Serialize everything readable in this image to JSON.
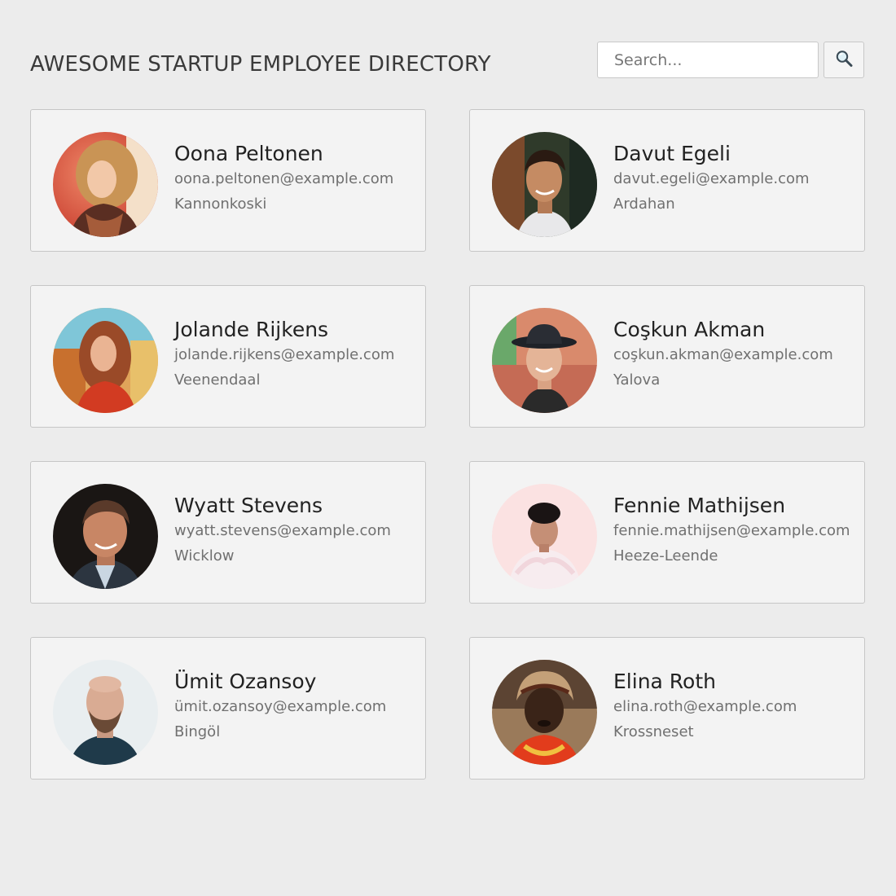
{
  "header": {
    "title": "AWESOME STARTUP EMPLOYEE DIRECTORY",
    "search": {
      "placeholder": "Search...",
      "value": "",
      "button_icon": "search-icon"
    }
  },
  "employees": [
    {
      "name": "Oona Peltonen",
      "email": "oona.peltonen@example.com",
      "city": "Kannonkoski"
    },
    {
      "name": "Davut Egeli",
      "email": "davut.egeli@example.com",
      "city": "Ardahan"
    },
    {
      "name": "Jolande Rijkens",
      "email": "jolande.rijkens@example.com",
      "city": "Veenendaal"
    },
    {
      "name": "Coşkun Akman",
      "email": "coşkun.akman@example.com",
      "city": "Yalova"
    },
    {
      "name": "Wyatt Stevens",
      "email": "wyatt.stevens@example.com",
      "city": "Wicklow"
    },
    {
      "name": "Fennie Mathijsen",
      "email": "fennie.mathijsen@example.com",
      "city": "Heeze-Leende"
    },
    {
      "name": "Ümit Ozansoy",
      "email": "ümit.ozansoy@example.com",
      "city": "Bingöl"
    },
    {
      "name": "Elina Roth",
      "email": "elina.roth@example.com",
      "city": "Krossneset"
    }
  ]
}
